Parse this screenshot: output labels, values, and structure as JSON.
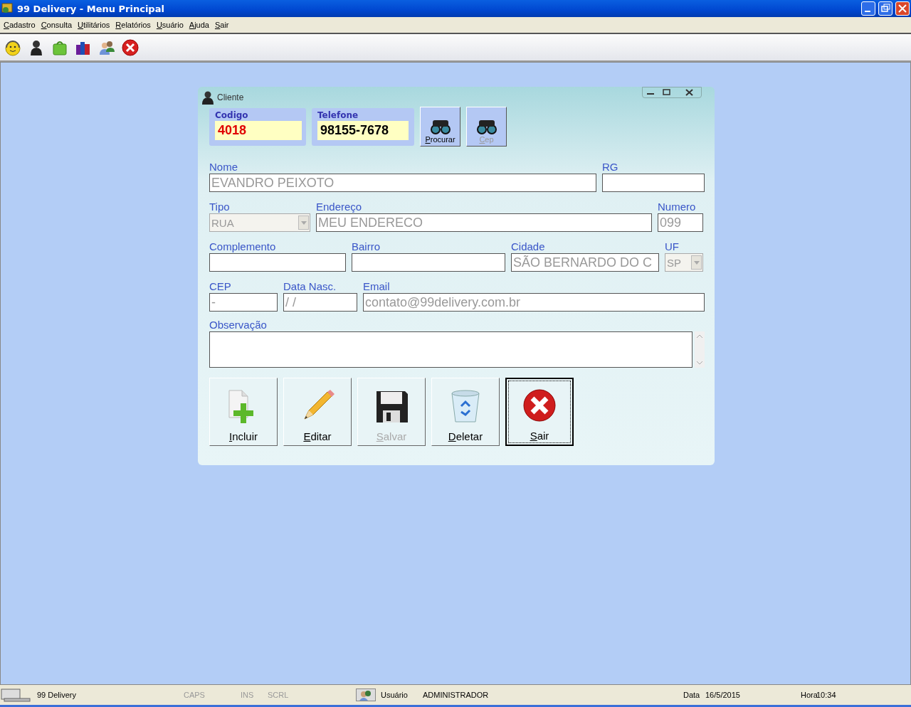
{
  "window": {
    "title": "99 Delivery - Menu Principal"
  },
  "menu": [
    "Cadastro",
    "Consulta",
    "Utilitários",
    "Relatórios",
    "Usuário",
    "Ajuda",
    "Sair"
  ],
  "toolbar": [
    {
      "kind": "support"
    },
    {
      "kind": "person"
    },
    {
      "kind": "bag"
    },
    {
      "kind": "products"
    },
    {
      "kind": "users"
    },
    {
      "kind": "close"
    }
  ],
  "form": {
    "title": "Cliente",
    "codigo": {
      "label": "Codigo",
      "value": "4018"
    },
    "telefone": {
      "label": "Telefone",
      "value": "98155-7678"
    },
    "search_buttons": [
      {
        "label": "Procurar",
        "disabled": false
      },
      {
        "label": "Cep",
        "disabled": true
      }
    ],
    "fields": [
      {
        "label": "Nome",
        "kind": "text",
        "value": "EVANDRO PEIXOTO",
        "disabled": true
      },
      {
        "label": "RG",
        "kind": "text"
      },
      {
        "label": "Tipo",
        "kind": "select",
        "value": "RUA",
        "disabled": true
      },
      {
        "label": "Endereço",
        "kind": "text",
        "value": "MEU ENDERECO",
        "disabled": true
      },
      {
        "label": "Numero",
        "kind": "text",
        "value": "099",
        "disabled": true
      },
      {
        "label": "Complemento",
        "kind": "text"
      },
      {
        "label": "Bairro",
        "kind": "text"
      },
      {
        "label": "Cidade",
        "kind": "text",
        "value": "SÃO BERNARDO DO C",
        "disabled": true
      },
      {
        "label": "UF",
        "kind": "select",
        "value": "SP",
        "disabled": true
      },
      {
        "label": "CEP",
        "kind": "text",
        "value": "-",
        "disabled": true
      },
      {
        "label": "Data Nasc.",
        "kind": "text",
        "value": "/ /",
        "disabled": true
      },
      {
        "label": "Email",
        "kind": "text",
        "value": "contato@99delivery.com.br",
        "disabled": true
      }
    ],
    "observacao": {
      "label": "Observação"
    },
    "actions": [
      {
        "label": "Incluir",
        "kind": "add",
        "disabled": false,
        "focused": false
      },
      {
        "label": "Editar",
        "kind": "edit",
        "disabled": false,
        "focused": false
      },
      {
        "label": "Salvar",
        "kind": "save",
        "disabled": true,
        "focused": false
      },
      {
        "label": "Deletar",
        "kind": "delete",
        "disabled": false,
        "focused": false
      },
      {
        "label": "Sair",
        "kind": "exit",
        "disabled": false,
        "focused": true
      }
    ]
  },
  "status_bar": {
    "app": "99 Delivery",
    "indicators": [
      {
        "label": "CAPS",
        "on": false
      },
      {
        "label": "INS",
        "on": false
      },
      {
        "label": "SCRL",
        "on": false
      }
    ],
    "user_label": "Usuário",
    "user": "ADMINISTRADOR",
    "date_label": "Data",
    "date": "16/5/2015",
    "time_label": "Hora",
    "time": "10:34"
  }
}
